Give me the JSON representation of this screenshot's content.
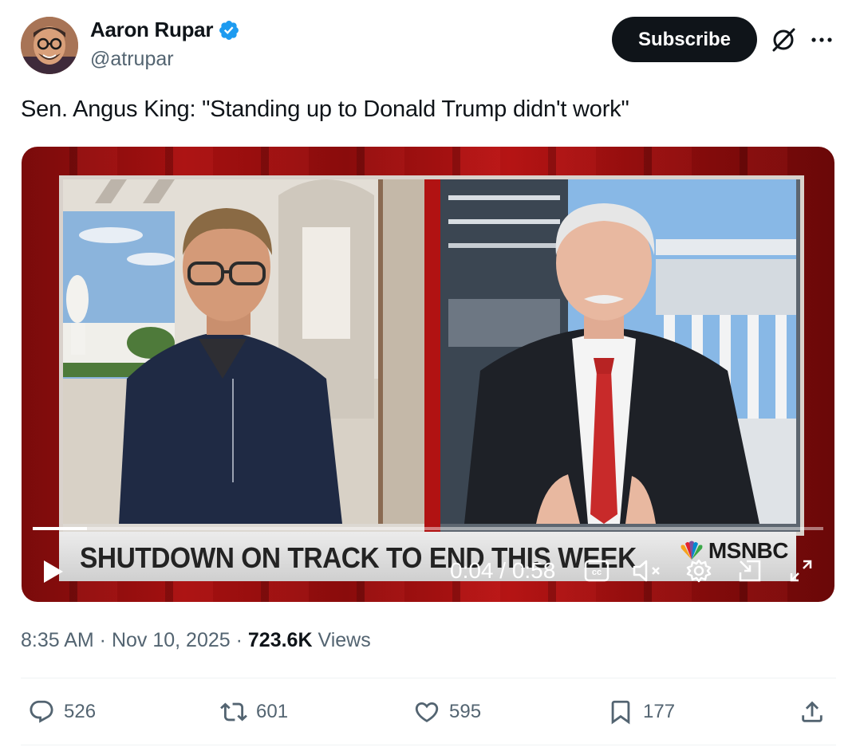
{
  "author": {
    "display_name": "Aaron Rupar",
    "handle": "@atrupar",
    "verified_icon": "verified-badge-icon",
    "verified_color": "#1d9bf0"
  },
  "header": {
    "subscribe_label": "Subscribe",
    "grok_icon": "grok-icon",
    "more_icon": "more-icon"
  },
  "tweet": {
    "text": "Sen. Angus King: \"Standing up to Donald Trump didn't work\""
  },
  "video": {
    "chyron": "SHUTDOWN ON TRACK TO END THIS WEEK",
    "network": "MSNBC",
    "time": "0:04 / 0:58",
    "progress": 0.069,
    "controls": [
      "play-icon",
      "captions-icon",
      "mute-icon",
      "settings-icon",
      "pip-icon",
      "fullscreen-icon"
    ],
    "accent_red": "#b11212"
  },
  "meta": {
    "time": "8:35 AM",
    "date": "Nov 10, 2025",
    "views_count": "723.6K",
    "views_label": "Views"
  },
  "actions": {
    "replies": "526",
    "reposts": "601",
    "likes": "595",
    "bookmarks": "177"
  }
}
